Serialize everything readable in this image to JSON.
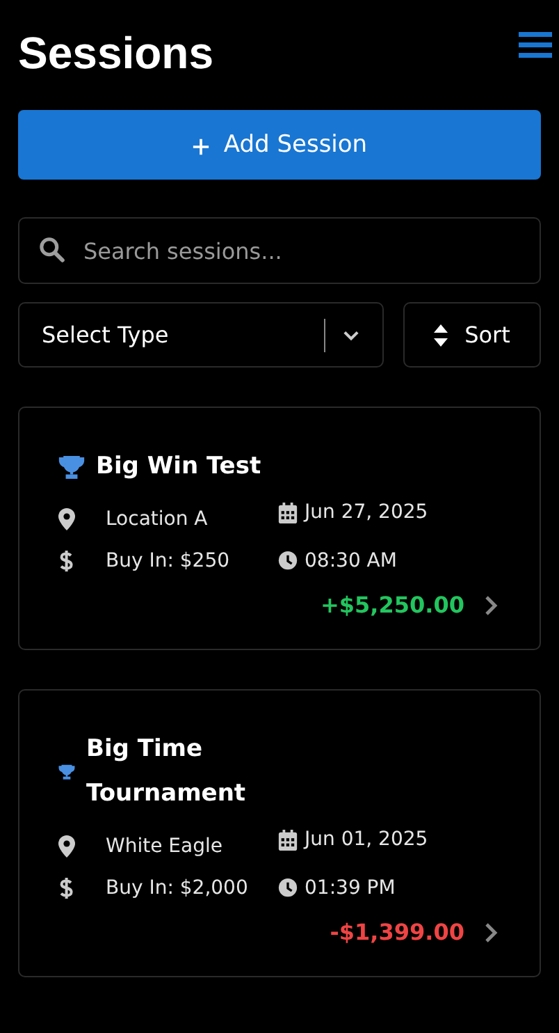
{
  "header": {
    "title": "Sessions"
  },
  "add_button": {
    "label": "Add Session"
  },
  "search": {
    "placeholder": "Search sessions..."
  },
  "type_select": {
    "value": "Select Type"
  },
  "sort_button": {
    "label": "Sort"
  },
  "sessions": [
    {
      "title": "Big Win Test",
      "location": "Location A",
      "buy_in": "Buy In: $250",
      "date": "Jun 27, 2025",
      "time": "08:30 AM",
      "result": "+$5,250.00",
      "color": "#22c55e"
    },
    {
      "title": "Big Time Tournament",
      "location": "White Eagle",
      "buy_in": "Buy In: $2,000",
      "date": "Jun 01, 2025",
      "time": "01:39 PM",
      "result": "-$1,399.00",
      "color": "#ef4444"
    }
  ]
}
